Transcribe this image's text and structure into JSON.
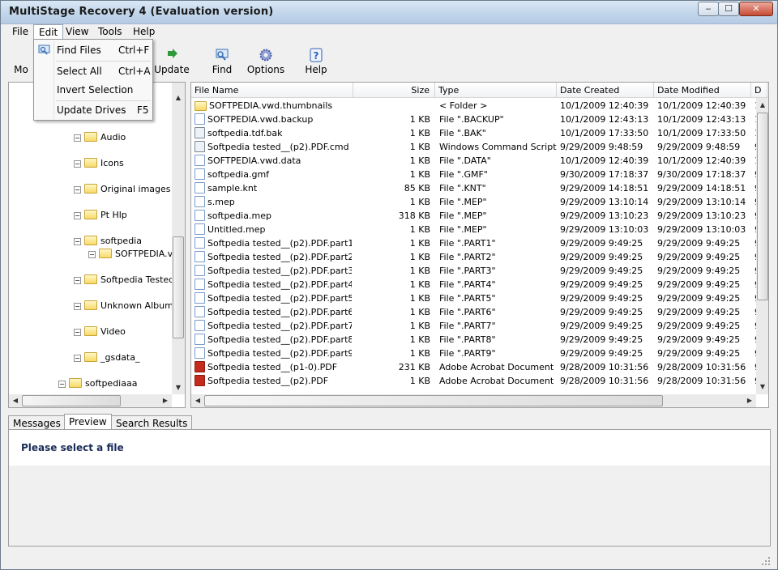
{
  "window": {
    "title": "MultiStage Recovery 4 (Evaluation version)",
    "min": "‒",
    "max": "☐",
    "close": "✕"
  },
  "menu": [
    "File",
    "Edit",
    "View",
    "Tools",
    "Help"
  ],
  "toolbar": {
    "partial_label": "Mo",
    "items": [
      {
        "label": "Update",
        "icon": "update-icon",
        "color": "#2e9a3a"
      },
      {
        "label": "Find",
        "icon": "find-icon",
        "color": "#3a6fb5"
      },
      {
        "label": "Options",
        "icon": "gear-icon",
        "color": "#4a5fa8"
      },
      {
        "label": "Help",
        "icon": "help-icon",
        "color": "#2f5fb8"
      }
    ]
  },
  "edit_menu": [
    {
      "label": "Find Files",
      "shortcut": "Ctrl+F"
    },
    {
      "label": "Select All",
      "shortcut": "Ctrl+A"
    },
    {
      "label": "Invert Selection",
      "shortcut": ""
    },
    {
      "label": "Update Drives",
      "shortcut": "F5"
    }
  ],
  "tree": {
    "nodes": [
      {
        "label": "Audio"
      },
      {
        "label": "Icons"
      },
      {
        "label": "Original images"
      },
      {
        "label": "Pt Hlp"
      },
      {
        "label": "softpedia"
      },
      {
        "label": "SOFTPEDIA.v"
      },
      {
        "label": "Softpedia Tested"
      },
      {
        "label": "Unknown Album"
      },
      {
        "label": "Video"
      },
      {
        "label": "_gsdata_"
      },
      {
        "label": "softpediaaa"
      }
    ]
  },
  "columns": [
    "File Name",
    "Size",
    "Type",
    "Date Created",
    "Date Modified",
    "D"
  ],
  "files": [
    {
      "icon": "folder",
      "name": "SOFTPEDIA.vwd.thumbnails",
      "size": "",
      "type": "< Folder >",
      "created": "10/1/2009 12:40:39",
      "modified": "10/1/2009 12:40:39",
      "extra": "1"
    },
    {
      "icon": "doc",
      "name": "SOFTPEDIA.vwd.backup",
      "size": "1 KB",
      "type": "File \".BACKUP\"",
      "created": "10/1/2009 12:43:13",
      "modified": "10/1/2009 12:43:13",
      "extra": "1"
    },
    {
      "icon": "cmd",
      "name": "softpedia.tdf.bak",
      "size": "1 KB",
      "type": "File \".BAK\"",
      "created": "10/1/2009 17:33:50",
      "modified": "10/1/2009 17:33:50",
      "extra": "1"
    },
    {
      "icon": "cmd",
      "name": "Softpedia tested__(p2).PDF.cmd",
      "size": "1 KB",
      "type": "Windows Command Script",
      "created": "9/29/2009 9:48:59",
      "modified": "9/29/2009 9:48:59",
      "extra": "9"
    },
    {
      "icon": "doc",
      "name": "SOFTPEDIA.vwd.data",
      "size": "1 KB",
      "type": "File \".DATA\"",
      "created": "10/1/2009 12:40:39",
      "modified": "10/1/2009 12:40:39",
      "extra": "1"
    },
    {
      "icon": "doc",
      "name": "softpedia.gmf",
      "size": "1 KB",
      "type": "File \".GMF\"",
      "created": "9/30/2009 17:18:37",
      "modified": "9/30/2009 17:18:37",
      "extra": "9"
    },
    {
      "icon": "doc",
      "name": "sample.knt",
      "size": "85 KB",
      "type": "File \".KNT\"",
      "created": "9/29/2009 14:18:51",
      "modified": "9/29/2009 14:18:51",
      "extra": "9"
    },
    {
      "icon": "doc",
      "name": "s.mep",
      "size": "1 KB",
      "type": "File \".MEP\"",
      "created": "9/29/2009 13:10:14",
      "modified": "9/29/2009 13:10:14",
      "extra": "9"
    },
    {
      "icon": "doc",
      "name": "softpedia.mep",
      "size": "318 KB",
      "type": "File \".MEP\"",
      "created": "9/29/2009 13:10:23",
      "modified": "9/29/2009 13:10:23",
      "extra": "9"
    },
    {
      "icon": "doc",
      "name": "Untitled.mep",
      "size": "1 KB",
      "type": "File \".MEP\"",
      "created": "9/29/2009 13:10:03",
      "modified": "9/29/2009 13:10:03",
      "extra": "9"
    },
    {
      "icon": "doc",
      "name": "Softpedia tested__(p2).PDF.part1",
      "size": "1 KB",
      "type": "File \".PART1\"",
      "created": "9/29/2009 9:49:25",
      "modified": "9/29/2009 9:49:25",
      "extra": "9"
    },
    {
      "icon": "doc",
      "name": "Softpedia tested__(p2).PDF.part2",
      "size": "1 KB",
      "type": "File \".PART2\"",
      "created": "9/29/2009 9:49:25",
      "modified": "9/29/2009 9:49:25",
      "extra": "9"
    },
    {
      "icon": "doc",
      "name": "Softpedia tested__(p2).PDF.part3",
      "size": "1 KB",
      "type": "File \".PART3\"",
      "created": "9/29/2009 9:49:25",
      "modified": "9/29/2009 9:49:25",
      "extra": "9"
    },
    {
      "icon": "doc",
      "name": "Softpedia tested__(p2).PDF.part4",
      "size": "1 KB",
      "type": "File \".PART4\"",
      "created": "9/29/2009 9:49:25",
      "modified": "9/29/2009 9:49:25",
      "extra": "9"
    },
    {
      "icon": "doc",
      "name": "Softpedia tested__(p2).PDF.part5",
      "size": "1 KB",
      "type": "File \".PART5\"",
      "created": "9/29/2009 9:49:25",
      "modified": "9/29/2009 9:49:25",
      "extra": "9"
    },
    {
      "icon": "doc",
      "name": "Softpedia tested__(p2).PDF.part6",
      "size": "1 KB",
      "type": "File \".PART6\"",
      "created": "9/29/2009 9:49:25",
      "modified": "9/29/2009 9:49:25",
      "extra": "9"
    },
    {
      "icon": "doc",
      "name": "Softpedia tested__(p2).PDF.part7",
      "size": "1 KB",
      "type": "File \".PART7\"",
      "created": "9/29/2009 9:49:25",
      "modified": "9/29/2009 9:49:25",
      "extra": "9"
    },
    {
      "icon": "doc",
      "name": "Softpedia tested__(p2).PDF.part8",
      "size": "1 KB",
      "type": "File \".PART8\"",
      "created": "9/29/2009 9:49:25",
      "modified": "9/29/2009 9:49:25",
      "extra": "9"
    },
    {
      "icon": "doc",
      "name": "Softpedia tested__(p2).PDF.part9",
      "size": "1 KB",
      "type": "File \".PART9\"",
      "created": "9/29/2009 9:49:25",
      "modified": "9/29/2009 9:49:25",
      "extra": "9"
    },
    {
      "icon": "pdf",
      "name": "Softpedia tested__(p1-0).PDF",
      "size": "231 KB",
      "type": "Adobe Acrobat Document",
      "created": "9/28/2009 10:31:56",
      "modified": "9/28/2009 10:31:56",
      "extra": "9"
    },
    {
      "icon": "pdf",
      "name": "Softpedia tested__(p2).PDF",
      "size": "1 KB",
      "type": "Adobe Acrobat Document",
      "created": "9/28/2009 10:31:56",
      "modified": "9/28/2009 10:31:56",
      "extra": "9"
    }
  ],
  "tabs": [
    "Messages",
    "Preview",
    "Search Results"
  ],
  "preview": {
    "message": "Please select a file"
  }
}
